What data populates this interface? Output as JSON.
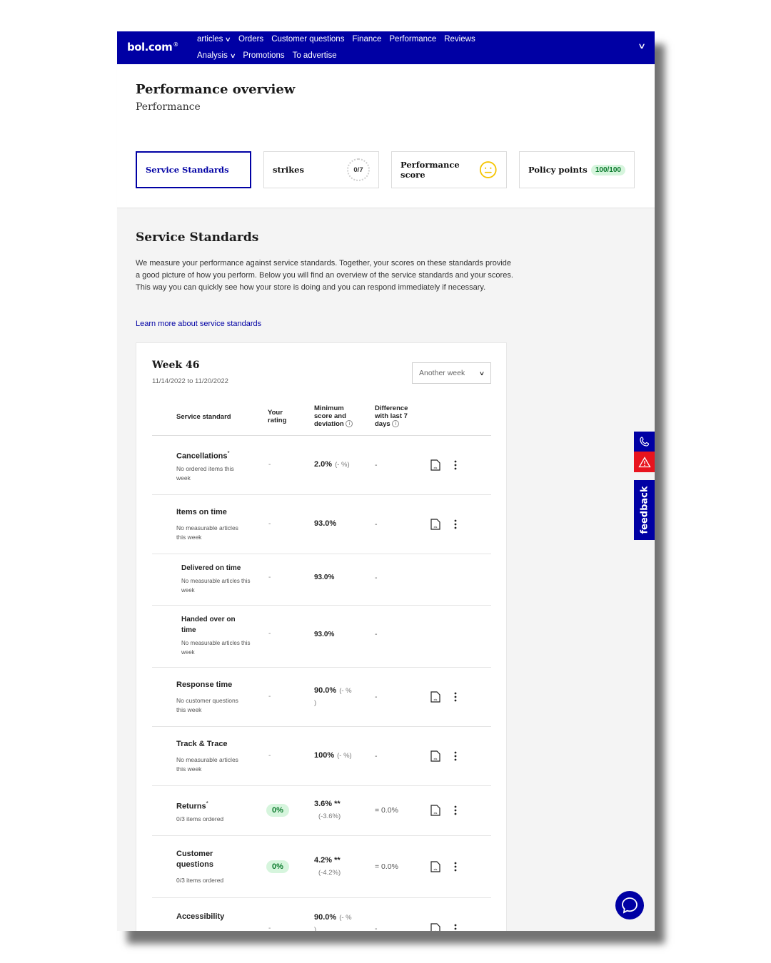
{
  "brand": {
    "logo": "bol.com",
    "logo_mark": "®"
  },
  "nav": {
    "row1": [
      {
        "label": "articles",
        "has_dropdown": true
      },
      {
        "label": "Orders"
      },
      {
        "label": "Customer questions"
      },
      {
        "label": "Finance"
      },
      {
        "label": "Performance"
      },
      {
        "label": "Reviews"
      }
    ],
    "row2": [
      {
        "label": "Analysis",
        "has_dropdown": true
      },
      {
        "label": "Promotions"
      },
      {
        "label": "To advertise"
      }
    ]
  },
  "page": {
    "title": "Performance overview",
    "subtitle": "Performance"
  },
  "tabs": {
    "service_standards": "Service Standards",
    "strikes": "strikes",
    "strikes_value": "0/7",
    "performance_score": "Performance score",
    "policy_points": "Policy points",
    "policy_points_value": "100/100"
  },
  "section": {
    "title": "Service Standards",
    "intro": "We measure your performance against service standards. Together, your scores on these standards provide a good picture of how you perform. Below you will find an overview of the service standards and your scores. This way you can quickly see how your store is doing and you can respond immediately if necessary.",
    "learn_more": "Learn more about service standards"
  },
  "week": {
    "title": "Week 46",
    "dates": "11/14/2022 to 11/20/2022",
    "select_label": "Another week"
  },
  "table": {
    "headers": {
      "standard": "Service standard",
      "rating_1": "Your",
      "rating_2": "rating",
      "minimum_1": "Minimum",
      "minimum_2": "score and",
      "minimum_3": "deviation",
      "diff_1": "Difference",
      "diff_2": "with last 7",
      "diff_3": "days"
    },
    "rows": [
      {
        "name": "Cancellations",
        "marker": "*",
        "note_1": "No ordered items this",
        "note_2": "week",
        "rating": "-",
        "minimum": "2.0%",
        "deviation": "(- %)",
        "diff": "-"
      },
      {
        "name": "Items on time",
        "note_1": "No measurable articles",
        "note_2": "this week",
        "rating": "-",
        "minimum": "93.0%",
        "diff": "-"
      },
      {
        "name": "Delivered on time",
        "note_1": "No measurable articles this",
        "note_2": "week",
        "rating": "-",
        "minimum": "93.0%",
        "diff": "-"
      },
      {
        "name_1": "Handed over on",
        "name_2": "time",
        "note_1": "No measurable articles this",
        "note_2": "week",
        "rating": "-",
        "minimum": "93.0%",
        "diff": "-"
      },
      {
        "name": "Response time",
        "note_1": "No customer questions",
        "note_2": "this week",
        "rating": "-",
        "minimum": "90.0%",
        "deviation": "(- %",
        "deviation_end": ")",
        "diff": "-"
      },
      {
        "name": "Track & Trace",
        "note_1": "No measurable articles",
        "note_2": "this week",
        "rating": "-",
        "minimum": "100%",
        "deviation": "(- %)",
        "diff": "-"
      },
      {
        "name": "Returns",
        "marker": "*",
        "note_1": "0/3 items ordered",
        "rating": "0%",
        "minimum": "3.6% **",
        "deviation": "(-3.6%)",
        "diff": "= 0.0%"
      },
      {
        "name_1": "Customer",
        "name_2": "questions",
        "note_1": "0/3 items ordered",
        "rating": "0%",
        "minimum": "4.2% **",
        "deviation": "(-4.2%)",
        "diff": "= 0.0%"
      },
      {
        "name": "Accessibility",
        "rating": "-",
        "minimum": "90.0%",
        "deviation": "(- %",
        "deviation_end": ")",
        "diff": "-"
      }
    ]
  },
  "side": {
    "feedback": "feedback"
  },
  "colors": {
    "brand_blue": "#0000a4",
    "success_green": "#0a7a2c",
    "success_bg": "#d6f5dd",
    "alert_red": "#e8141e"
  }
}
